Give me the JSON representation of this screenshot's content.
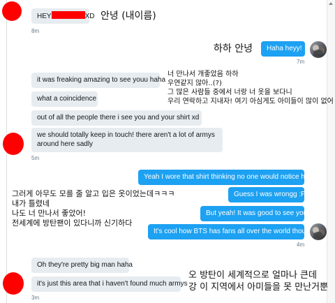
{
  "colors": {
    "incoming_bubble": "#e6ecf0",
    "outgoing_bubble": "#1da1f2",
    "redaction": "#ff0000",
    "timestamp": "#657786"
  },
  "messages": [
    {
      "id": "m1",
      "dir": "in",
      "text_prefix": "HEY",
      "text_suffix": "XD",
      "redacted_middle": true
    },
    {
      "id": "m2",
      "dir": "out",
      "text": "Haha heyy!"
    },
    {
      "id": "m3",
      "dir": "in",
      "text": "it was freaking amazing to see youu haha"
    },
    {
      "id": "m4",
      "dir": "in",
      "text": "what a coincidence"
    },
    {
      "id": "m5",
      "dir": "in",
      "text": "out of all the people there i see you and your shirt xd"
    },
    {
      "id": "m6",
      "dir": "in",
      "text_line1": "we should totally keep in touch! there aren't a lot of armys",
      "text_line2": "around here sadly"
    },
    {
      "id": "m7",
      "dir": "out",
      "text": "Yeah I wore that shirt thinking no one would notice haha"
    },
    {
      "id": "m8",
      "dir": "out",
      "text": "Guess I was wrongg :P"
    },
    {
      "id": "m9",
      "dir": "out",
      "text": "But yeah! It was good to see you"
    },
    {
      "id": "m10",
      "dir": "out",
      "text": "It's cool how BTS has fans all over the world though"
    },
    {
      "id": "m11",
      "dir": "in",
      "text": "Oh they're pretty big man haha"
    },
    {
      "id": "m12",
      "dir": "in",
      "text": "it's just this area that i haven't found much armys"
    }
  ],
  "timestamps": {
    "t1": "8m",
    "t2": "7m",
    "t3": "5m",
    "t4": "4m",
    "t5": "3m"
  },
  "translations": {
    "n1": "안녕 (내이름)",
    "n2": "하하 안녕",
    "n3": [
      "너 만나서 개좋았음 하하",
      "우연같지 않아..(?)",
      "그 많은 사람들 중에서 너랑 너 옷을 보다니",
      "우리 연락하고 지내자! 여기 아심게도 아미들이 많이 없어"
    ],
    "n4": [
      "그러게 아무도 모를 줄 알고 입은 옷이었는데ㅋㅋㅋ",
      "내가 틀렸네",
      "나도 너 만나서 좋았어!",
      "전세계에 방탄팬이 있다니까 신기하다"
    ],
    "n5": [
      "오 방탄이 세계적으로 얼마나 큰데",
      "강 이 지역에서 아미들을 못 만난거뿐"
    ]
  }
}
